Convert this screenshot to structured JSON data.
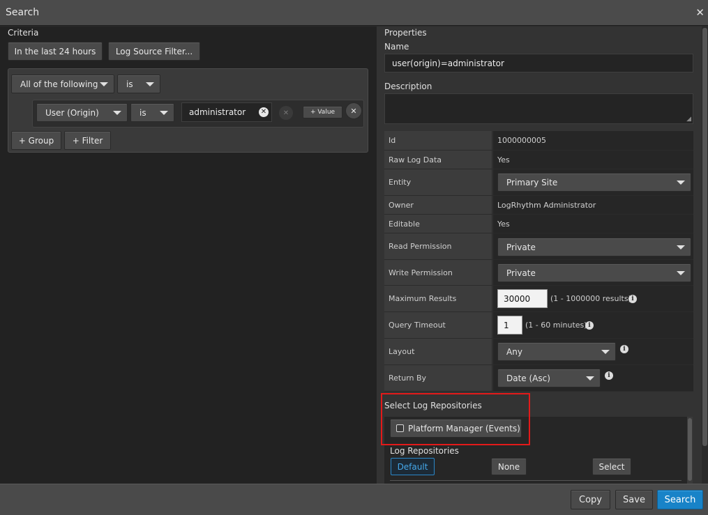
{
  "window": {
    "title": "Search",
    "close_icon": "close-icon"
  },
  "criteria": {
    "heading": "Criteria",
    "time_button": "In the last 24 hours",
    "log_source_button": "Log Source Filter...",
    "group_operator": "All of the following",
    "group_is": "is",
    "filter": {
      "field": "User (Origin)",
      "operator": "is",
      "value": "administrator",
      "add_value_button": "+ Value"
    },
    "add_group_button": "+ Group",
    "add_filter_button": "+ Filter"
  },
  "properties": {
    "heading": "Properties",
    "name_label": "Name",
    "name_value": "user(origin)=administrator",
    "description_label": "Description",
    "description_value": "",
    "rows": {
      "id": {
        "key": "Id",
        "value": "1000000005"
      },
      "raw": {
        "key": "Raw Log Data",
        "value": "Yes"
      },
      "entity": {
        "key": "Entity",
        "value": "Primary Site"
      },
      "owner": {
        "key": "Owner",
        "value": "LogRhythm Administrator"
      },
      "editable": {
        "key": "Editable",
        "value": "Yes"
      },
      "read": {
        "key": "Read Permission",
        "value": "Private"
      },
      "write": {
        "key": "Write Permission",
        "value": "Private"
      },
      "maxres": {
        "key": "Maximum Results",
        "value": "30000",
        "hint": "(1 - 1000000 results)"
      },
      "timeout": {
        "key": "Query Timeout",
        "value": "1",
        "hint": "(1 - 60 minutes)"
      },
      "layout": {
        "key": "Layout",
        "value": "Any"
      },
      "returnby": {
        "key": "Return By",
        "value": "Date (Asc)"
      }
    },
    "info_icon": "i"
  },
  "repositories": {
    "select_heading": "Select Log Repositories",
    "platform_manager": "Platform Manager (Events)",
    "platform_manager_checked": false,
    "heading": "Log Repositories",
    "default_button": "Default",
    "none_button": "None",
    "select_button": "Select"
  },
  "footer": {
    "copy_button": "Copy",
    "save_button": "Save",
    "search_button": "Search"
  },
  "colors": {
    "primary": "#1883c8",
    "highlight": "#e31a1a"
  }
}
